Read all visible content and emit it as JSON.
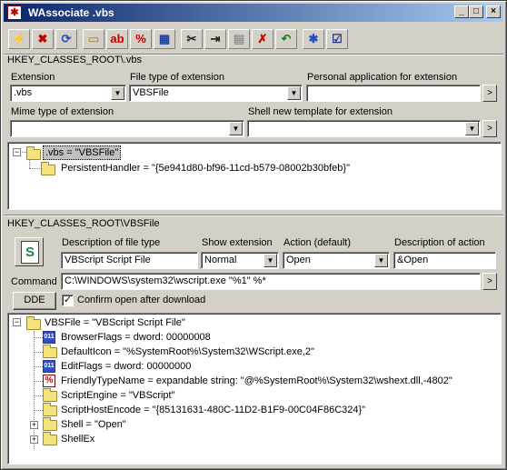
{
  "window": {
    "title": "WAssociate .vbs",
    "app_icon": "wassociate-icon",
    "controls": [
      "minimize-icon",
      "maximize-icon",
      "close-icon"
    ]
  },
  "toolbar": {
    "buttons": [
      {
        "name": "lightning-icon",
        "glyph": "⚡",
        "color": "#d0a000"
      },
      {
        "name": "delete-association-icon",
        "glyph": "✖",
        "color": "#c00000"
      },
      {
        "name": "refresh-association-icon",
        "glyph": "⟳",
        "color": "#2050c0"
      },
      {
        "name": "new-folder-icon",
        "glyph": "▭",
        "color": "#c0a020"
      },
      {
        "name": "string-value-icon",
        "glyph": "ab",
        "color": "#c00000"
      },
      {
        "name": "expandable-string-icon",
        "glyph": "%",
        "color": "#c00000"
      },
      {
        "name": "dword-value-icon",
        "glyph": "▦",
        "color": "#2040a0"
      },
      {
        "name": "cut-icon",
        "glyph": "✂",
        "color": "#202020"
      },
      {
        "name": "rename-icon",
        "glyph": "⇥",
        "color": "#202020"
      },
      {
        "name": "paste-icon",
        "glyph": "▤",
        "color": "#909090"
      },
      {
        "name": "delete-icon",
        "glyph": "✗",
        "color": "#c00000"
      },
      {
        "name": "undo-icon",
        "glyph": "↶",
        "color": "#208020"
      },
      {
        "name": "explorer-icon",
        "glyph": "✱",
        "color": "#2050c0"
      },
      {
        "name": "properties-icon",
        "glyph": "☑",
        "color": "#203080"
      }
    ]
  },
  "extension_section": {
    "path": "HKEY_CLASSES_ROOT\\.vbs",
    "extension_label": "Extension",
    "extension_value": ".vbs",
    "filetype_label": "File type of extension",
    "filetype_value": "VBSFile",
    "personal_app_label": "Personal application for extension",
    "personal_app_value": "",
    "mime_label": "Mime type of extension",
    "mime_value": "",
    "shell_template_label": "Shell new template for extension",
    "shell_template_value": "",
    "tree": [
      {
        "text": ".vbs = \"VBSFile\"",
        "level": 0,
        "expander": "−",
        "selected": true
      },
      {
        "text": "PersistentHandler = \"{5e941d80-bf96-11cd-b579-08002b30bfeb}\"",
        "level": 1
      }
    ]
  },
  "filetype_section": {
    "path": "HKEY_CLASSES_ROOT\\VBSFile",
    "desc_label": "Description of file type",
    "desc_value": "VBScript Script File",
    "show_ext_label": "Show extension",
    "show_ext_value": "Normal",
    "action_label": "Action (default)",
    "action_value": "Open",
    "action_desc_label": "Description of action",
    "action_desc_value": "&Open",
    "command_label": "Command",
    "command_value": "C:\\WINDOWS\\system32\\wscript.exe \"%1\" %*",
    "dde_label": "DDE",
    "confirm_label": "Confirm open after download",
    "confirm_checked": true,
    "tree": [
      {
        "text": "VBSFile = \"VBScript Script File\"",
        "icon": "folder",
        "expander": "−"
      },
      {
        "text": "BrowserFlags = dword: 00000008",
        "icon": "dword"
      },
      {
        "text": "DefaultIcon = \"%SystemRoot%\\System32\\WScript.exe,2\"",
        "icon": "folder"
      },
      {
        "text": "EditFlags = dword: 00000000",
        "icon": "dword"
      },
      {
        "text": "FriendlyTypeName = expandable string: \"@%SystemRoot%\\System32\\wshext.dll,-4802\"",
        "icon": "expstring"
      },
      {
        "text": "ScriptEngine = \"VBScript\"",
        "icon": "folder"
      },
      {
        "text": "ScriptHostEncode = \"{85131631-480C-11D2-B1F9-00C04F86C324}\"",
        "icon": "folder"
      },
      {
        "text": "Shell = \"Open\"",
        "icon": "folder",
        "expander": "+"
      },
      {
        "text": "ShellEx",
        "icon": "folder",
        "expander": "+"
      }
    ]
  }
}
